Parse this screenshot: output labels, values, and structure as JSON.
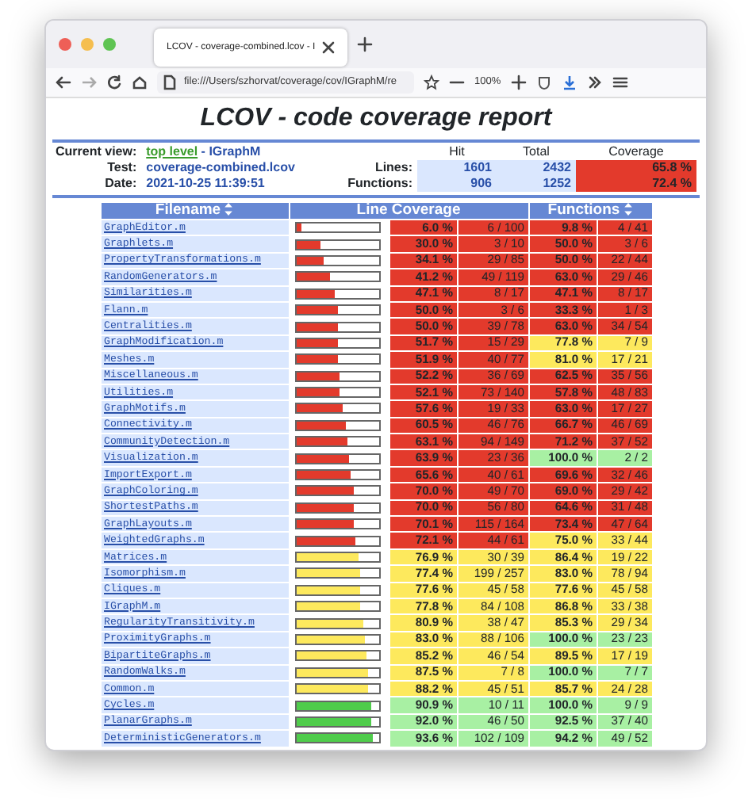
{
  "browser": {
    "tab_title": "LCOV - coverage-combined.lcov - I",
    "url": "file:///Users/szhorvat/coverage/cov/IGraphM/re",
    "zoom": "100%"
  },
  "report": {
    "title": "LCOV - code coverage report",
    "info": [
      {
        "label": "Current view:",
        "link": "top level",
        "value": " - IGraphM"
      },
      {
        "label": "Test:",
        "value": "coverage-combined.lcov"
      },
      {
        "label": "Date:",
        "value": "2021-10-25 11:39:51"
      }
    ],
    "summary": {
      "columns": [
        "Hit",
        "Total",
        "Coverage"
      ],
      "rows": [
        {
          "label": "Lines:",
          "hit": "1601",
          "total": "2432",
          "coverage": "65.8 %",
          "color": "#e33a2c"
        },
        {
          "label": "Functions:",
          "hit": "906",
          "total": "1252",
          "coverage": "72.4 %",
          "color": "#e33a2c"
        }
      ]
    }
  },
  "table": {
    "columns": [
      "Filename",
      "Line Coverage",
      "Functions"
    ],
    "rows": [
      {
        "file": "GraphEditor.m",
        "bar": {
          "level": 0.06,
          "color": "#e33a2c"
        },
        "lines": {
          "pct": "6.0 %",
          "count": "6 / 100",
          "color": "#e33a2c"
        },
        "functions": {
          "pct": "9.8 %",
          "count": "4 / 41",
          "color": "#e33a2c"
        }
      },
      {
        "file": "Graphlets.m",
        "bar": {
          "level": 0.3,
          "color": "#e33a2c"
        },
        "lines": {
          "pct": "30.0 %",
          "count": "3 / 10",
          "color": "#e33a2c"
        },
        "functions": {
          "pct": "50.0 %",
          "count": "3 / 6",
          "color": "#e33a2c"
        }
      },
      {
        "file": "PropertyTransformations.m",
        "bar": {
          "level": 0.341,
          "color": "#e33a2c"
        },
        "lines": {
          "pct": "34.1 %",
          "count": "29 / 85",
          "color": "#e33a2c"
        },
        "functions": {
          "pct": "50.0 %",
          "count": "22 / 44",
          "color": "#e33a2c"
        }
      },
      {
        "file": "RandomGenerators.m",
        "bar": {
          "level": 0.412,
          "color": "#e33a2c"
        },
        "lines": {
          "pct": "41.2 %",
          "count": "49 / 119",
          "color": "#e33a2c"
        },
        "functions": {
          "pct": "63.0 %",
          "count": "29 / 46",
          "color": "#e33a2c"
        }
      },
      {
        "file": "Similarities.m",
        "bar": {
          "level": 0.471,
          "color": "#e33a2c"
        },
        "lines": {
          "pct": "47.1 %",
          "count": "8 / 17",
          "color": "#e33a2c"
        },
        "functions": {
          "pct": "47.1 %",
          "count": "8 / 17",
          "color": "#e33a2c"
        }
      },
      {
        "file": "Flann.m",
        "bar": {
          "level": 0.5,
          "color": "#e33a2c"
        },
        "lines": {
          "pct": "50.0 %",
          "count": "3 / 6",
          "color": "#e33a2c"
        },
        "functions": {
          "pct": "33.3 %",
          "count": "1 / 3",
          "color": "#e33a2c"
        }
      },
      {
        "file": "Centralities.m",
        "bar": {
          "level": 0.5,
          "color": "#e33a2c"
        },
        "lines": {
          "pct": "50.0 %",
          "count": "39 / 78",
          "color": "#e33a2c"
        },
        "functions": {
          "pct": "63.0 %",
          "count": "34 / 54",
          "color": "#e33a2c"
        }
      },
      {
        "file": "GraphModification.m",
        "bar": {
          "level": 0.517,
          "color": "#e33a2c"
        },
        "lines": {
          "pct": "51.7 %",
          "count": "15 / 29",
          "color": "#e33a2c"
        },
        "functions": {
          "pct": "77.8 %",
          "count": "7 / 9",
          "color": "#fde95d"
        }
      },
      {
        "file": "Meshes.m",
        "bar": {
          "level": 0.519,
          "color": "#e33a2c"
        },
        "lines": {
          "pct": "51.9 %",
          "count": "40 / 77",
          "color": "#e33a2c"
        },
        "functions": {
          "pct": "81.0 %",
          "count": "17 / 21",
          "color": "#fde95d"
        }
      },
      {
        "file": "Miscellaneous.m",
        "bar": {
          "level": 0.522,
          "color": "#e33a2c"
        },
        "lines": {
          "pct": "52.2 %",
          "count": "36 / 69",
          "color": "#e33a2c"
        },
        "functions": {
          "pct": "62.5 %",
          "count": "35 / 56",
          "color": "#e33a2c"
        }
      },
      {
        "file": "Utilities.m",
        "bar": {
          "level": 0.521,
          "color": "#e33a2c"
        },
        "lines": {
          "pct": "52.1 %",
          "count": "73 / 140",
          "color": "#e33a2c"
        },
        "functions": {
          "pct": "57.8 %",
          "count": "48 / 83",
          "color": "#e33a2c"
        }
      },
      {
        "file": "GraphMotifs.m",
        "bar": {
          "level": 0.576,
          "color": "#e33a2c"
        },
        "lines": {
          "pct": "57.6 %",
          "count": "19 / 33",
          "color": "#e33a2c"
        },
        "functions": {
          "pct": "63.0 %",
          "count": "17 / 27",
          "color": "#e33a2c"
        }
      },
      {
        "file": "Connectivity.m",
        "bar": {
          "level": 0.605,
          "color": "#e33a2c"
        },
        "lines": {
          "pct": "60.5 %",
          "count": "46 / 76",
          "color": "#e33a2c"
        },
        "functions": {
          "pct": "66.7 %",
          "count": "46 / 69",
          "color": "#e33a2c"
        }
      },
      {
        "file": "CommunityDetection.m",
        "bar": {
          "level": 0.631,
          "color": "#e33a2c"
        },
        "lines": {
          "pct": "63.1 %",
          "count": "94 / 149",
          "color": "#e33a2c"
        },
        "functions": {
          "pct": "71.2 %",
          "count": "37 / 52",
          "color": "#e33a2c"
        }
      },
      {
        "file": "Visualization.m",
        "bar": {
          "level": 0.639,
          "color": "#e33a2c"
        },
        "lines": {
          "pct": "63.9 %",
          "count": "23 / 36",
          "color": "#e33a2c"
        },
        "functions": {
          "pct": "100.0 %",
          "count": "2 / 2",
          "color": "#a8f0a3"
        }
      },
      {
        "file": "ImportExport.m",
        "bar": {
          "level": 0.656,
          "color": "#e33a2c"
        },
        "lines": {
          "pct": "65.6 %",
          "count": "40 / 61",
          "color": "#e33a2c"
        },
        "functions": {
          "pct": "69.6 %",
          "count": "32 / 46",
          "color": "#e33a2c"
        }
      },
      {
        "file": "GraphColoring.m",
        "bar": {
          "level": 0.7,
          "color": "#e33a2c"
        },
        "lines": {
          "pct": "70.0 %",
          "count": "49 / 70",
          "color": "#e33a2c"
        },
        "functions": {
          "pct": "69.0 %",
          "count": "29 / 42",
          "color": "#e33a2c"
        }
      },
      {
        "file": "ShortestPaths.m",
        "bar": {
          "level": 0.7,
          "color": "#e33a2c"
        },
        "lines": {
          "pct": "70.0 %",
          "count": "56 / 80",
          "color": "#e33a2c"
        },
        "functions": {
          "pct": "64.6 %",
          "count": "31 / 48",
          "color": "#e33a2c"
        }
      },
      {
        "file": "GraphLayouts.m",
        "bar": {
          "level": 0.701,
          "color": "#e33a2c"
        },
        "lines": {
          "pct": "70.1 %",
          "count": "115 / 164",
          "color": "#e33a2c"
        },
        "functions": {
          "pct": "73.4 %",
          "count": "47 / 64",
          "color": "#e33a2c"
        }
      },
      {
        "file": "WeightedGraphs.m",
        "bar": {
          "level": 0.721,
          "color": "#e33a2c"
        },
        "lines": {
          "pct": "72.1 %",
          "count": "44 / 61",
          "color": "#e33a2c"
        },
        "functions": {
          "pct": "75.0 %",
          "count": "33 / 44",
          "color": "#fde95d"
        }
      },
      {
        "file": "Matrices.m",
        "bar": {
          "level": 0.769,
          "color": "#fde95d"
        },
        "lines": {
          "pct": "76.9 %",
          "count": "30 / 39",
          "color": "#fde95d"
        },
        "functions": {
          "pct": "86.4 %",
          "count": "19 / 22",
          "color": "#fde95d"
        }
      },
      {
        "file": "Isomorphism.m",
        "bar": {
          "level": 0.774,
          "color": "#fde95d"
        },
        "lines": {
          "pct": "77.4 %",
          "count": "199 / 257",
          "color": "#fde95d"
        },
        "functions": {
          "pct": "83.0 %",
          "count": "78 / 94",
          "color": "#fde95d"
        }
      },
      {
        "file": "Cliques.m",
        "bar": {
          "level": 0.776,
          "color": "#fde95d"
        },
        "lines": {
          "pct": "77.6 %",
          "count": "45 / 58",
          "color": "#fde95d"
        },
        "functions": {
          "pct": "77.6 %",
          "count": "45 / 58",
          "color": "#fde95d"
        }
      },
      {
        "file": "IGraphM.m",
        "bar": {
          "level": 0.778,
          "color": "#fde95d"
        },
        "lines": {
          "pct": "77.8 %",
          "count": "84 / 108",
          "color": "#fde95d"
        },
        "functions": {
          "pct": "86.8 %",
          "count": "33 / 38",
          "color": "#fde95d"
        }
      },
      {
        "file": "RegularityTransitivity.m",
        "bar": {
          "level": 0.809,
          "color": "#fde95d"
        },
        "lines": {
          "pct": "80.9 %",
          "count": "38 / 47",
          "color": "#fde95d"
        },
        "functions": {
          "pct": "85.3 %",
          "count": "29 / 34",
          "color": "#fde95d"
        }
      },
      {
        "file": "ProximityGraphs.m",
        "bar": {
          "level": 0.83,
          "color": "#fde95d"
        },
        "lines": {
          "pct": "83.0 %",
          "count": "88 / 106",
          "color": "#fde95d"
        },
        "functions": {
          "pct": "100.0 %",
          "count": "23 / 23",
          "color": "#a8f0a3"
        }
      },
      {
        "file": "BipartiteGraphs.m",
        "bar": {
          "level": 0.852,
          "color": "#fde95d"
        },
        "lines": {
          "pct": "85.2 %",
          "count": "46 / 54",
          "color": "#fde95d"
        },
        "functions": {
          "pct": "89.5 %",
          "count": "17 / 19",
          "color": "#fde95d"
        }
      },
      {
        "file": "RandomWalks.m",
        "bar": {
          "level": 0.875,
          "color": "#fde95d"
        },
        "lines": {
          "pct": "87.5 %",
          "count": "7 / 8",
          "color": "#fde95d"
        },
        "functions": {
          "pct": "100.0 %",
          "count": "7 / 7",
          "color": "#a8f0a3"
        }
      },
      {
        "file": "Common.m",
        "bar": {
          "level": 0.882,
          "color": "#fde95d"
        },
        "lines": {
          "pct": "88.2 %",
          "count": "45 / 51",
          "color": "#fde95d"
        },
        "functions": {
          "pct": "85.7 %",
          "count": "24 / 28",
          "color": "#fde95d"
        }
      },
      {
        "file": "Cycles.m",
        "bar": {
          "level": 0.909,
          "color": "#4fcc4b"
        },
        "lines": {
          "pct": "90.9 %",
          "count": "10 / 11",
          "color": "#a8f0a3"
        },
        "functions": {
          "pct": "100.0 %",
          "count": "9 / 9",
          "color": "#a8f0a3"
        }
      },
      {
        "file": "PlanarGraphs.m",
        "bar": {
          "level": 0.92,
          "color": "#4fcc4b"
        },
        "lines": {
          "pct": "92.0 %",
          "count": "46 / 50",
          "color": "#a8f0a3"
        },
        "functions": {
          "pct": "92.5 %",
          "count": "37 / 40",
          "color": "#a8f0a3"
        }
      },
      {
        "file": "DeterministicGenerators.m",
        "bar": {
          "level": 0.936,
          "color": "#4fcc4b"
        },
        "lines": {
          "pct": "93.6 %",
          "count": "102 / 109",
          "color": "#a8f0a3"
        },
        "functions": {
          "pct": "94.2 %",
          "count": "49 / 52",
          "color": "#a8f0a3"
        }
      }
    ]
  }
}
